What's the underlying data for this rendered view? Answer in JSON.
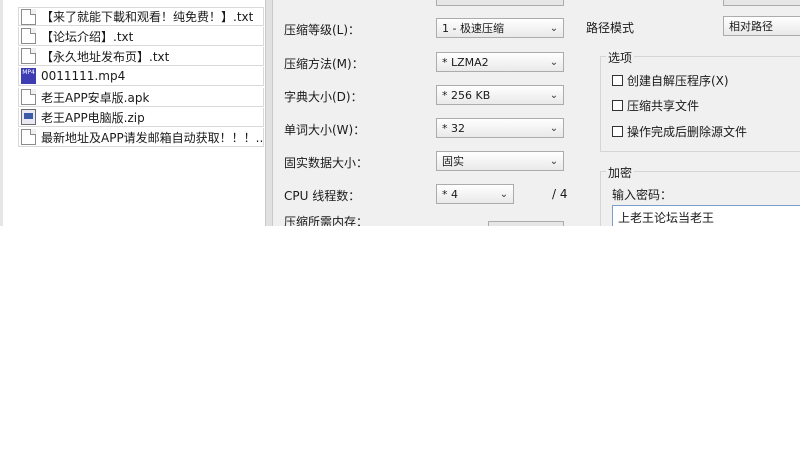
{
  "files": [
    {
      "name": "【来了就能下載和观看！纯免费！】.txt",
      "type": "txt"
    },
    {
      "name": "【论坛介绍】.txt",
      "type": "txt"
    },
    {
      "name": "【永久地址发布页】.txt",
      "type": "txt"
    },
    {
      "name": "0011111.mp4",
      "type": "mp4",
      "icon_text": "MP4"
    },
    {
      "name": "老王APP安卓版.apk",
      "type": "txt"
    },
    {
      "name": "老王APP电脑版.zip",
      "type": "zip"
    },
    {
      "name": "最新地址及APP请发邮箱自动获取！！！...",
      "type": "txt"
    }
  ],
  "compression": {
    "level_label": "压缩等级(L)：",
    "level_value": "1 - 极速压缩",
    "method_label": "压缩方法(M)：",
    "method_value": "* LZMA2",
    "dict_label": "字典大小(D)：",
    "dict_value": "* 256 KB",
    "word_label": "单词大小(W)：",
    "word_value": "* 32",
    "solid_label": "固实数据大小：",
    "solid_value": "固实",
    "cpu_label": "CPU 线程数：",
    "cpu_value": "* 4",
    "cpu_total": "/ 4",
    "memory_label": "压缩所需内存："
  },
  "path": {
    "label": "路径模式",
    "value": "相对路径"
  },
  "options": {
    "title": "选项",
    "items": [
      "创建自解压程序(X)",
      "压缩共享文件",
      "操作完成后删除源文件"
    ]
  },
  "encryption": {
    "title": "加密",
    "password_label": "输入密码：",
    "password_value": "上老王论坛当老王"
  }
}
